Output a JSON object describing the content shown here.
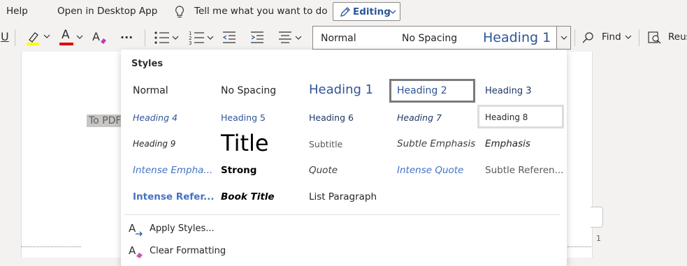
{
  "menubar": {
    "help": "Help",
    "open_desktop": "Open in Desktop App",
    "tell_me": "Tell me what you want to do",
    "editing": "Editing"
  },
  "ribbon": {
    "underline": "U",
    "font_color_letter": "A",
    "more": "···",
    "styles_box": {
      "normal": "Normal",
      "no_spacing": "No Spacing",
      "heading1": "Heading 1"
    },
    "find": "Find",
    "reuse": "Reus"
  },
  "document": {
    "text": "To PDF",
    "page_number": "1"
  },
  "styles_dropdown": {
    "title": "Styles",
    "selected": "Heading 2",
    "hovered": "Heading 8",
    "rows": [
      [
        "Normal",
        "No Spacing",
        "Heading 1",
        "Heading 2",
        "Heading 3"
      ],
      [
        "Heading 4",
        "Heading 5",
        "Heading 6",
        "Heading 7",
        "Heading 8"
      ],
      [
        "Heading 9",
        "Title",
        "Subtitle",
        "Subtle Emphasis",
        "Emphasis"
      ],
      [
        "Intense Empha...",
        "Strong",
        "Quote",
        "Intense Quote",
        "Subtle Referen..."
      ],
      [
        "Intense Refer...",
        "Book Title",
        "List Paragraph"
      ]
    ],
    "apply_styles": "Apply Styles...",
    "clear_formatting": "Clear Formatting"
  },
  "colors": {
    "accent": "#2b579a",
    "heading_blue": "#2f5496",
    "highlight_yellow": "#ffff00",
    "font_red": "#e00000"
  },
  "icons": [
    "lightbulb-icon",
    "pencil-icon",
    "chevron-down-icon",
    "highlighter-icon",
    "font-color-icon",
    "clear-format-icon",
    "bullets-icon",
    "numbering-icon",
    "decrease-indent-icon",
    "increase-indent-icon",
    "align-icon",
    "search-icon",
    "reuse-icon",
    "apply-styles-icon",
    "clear-formatting-icon"
  ]
}
